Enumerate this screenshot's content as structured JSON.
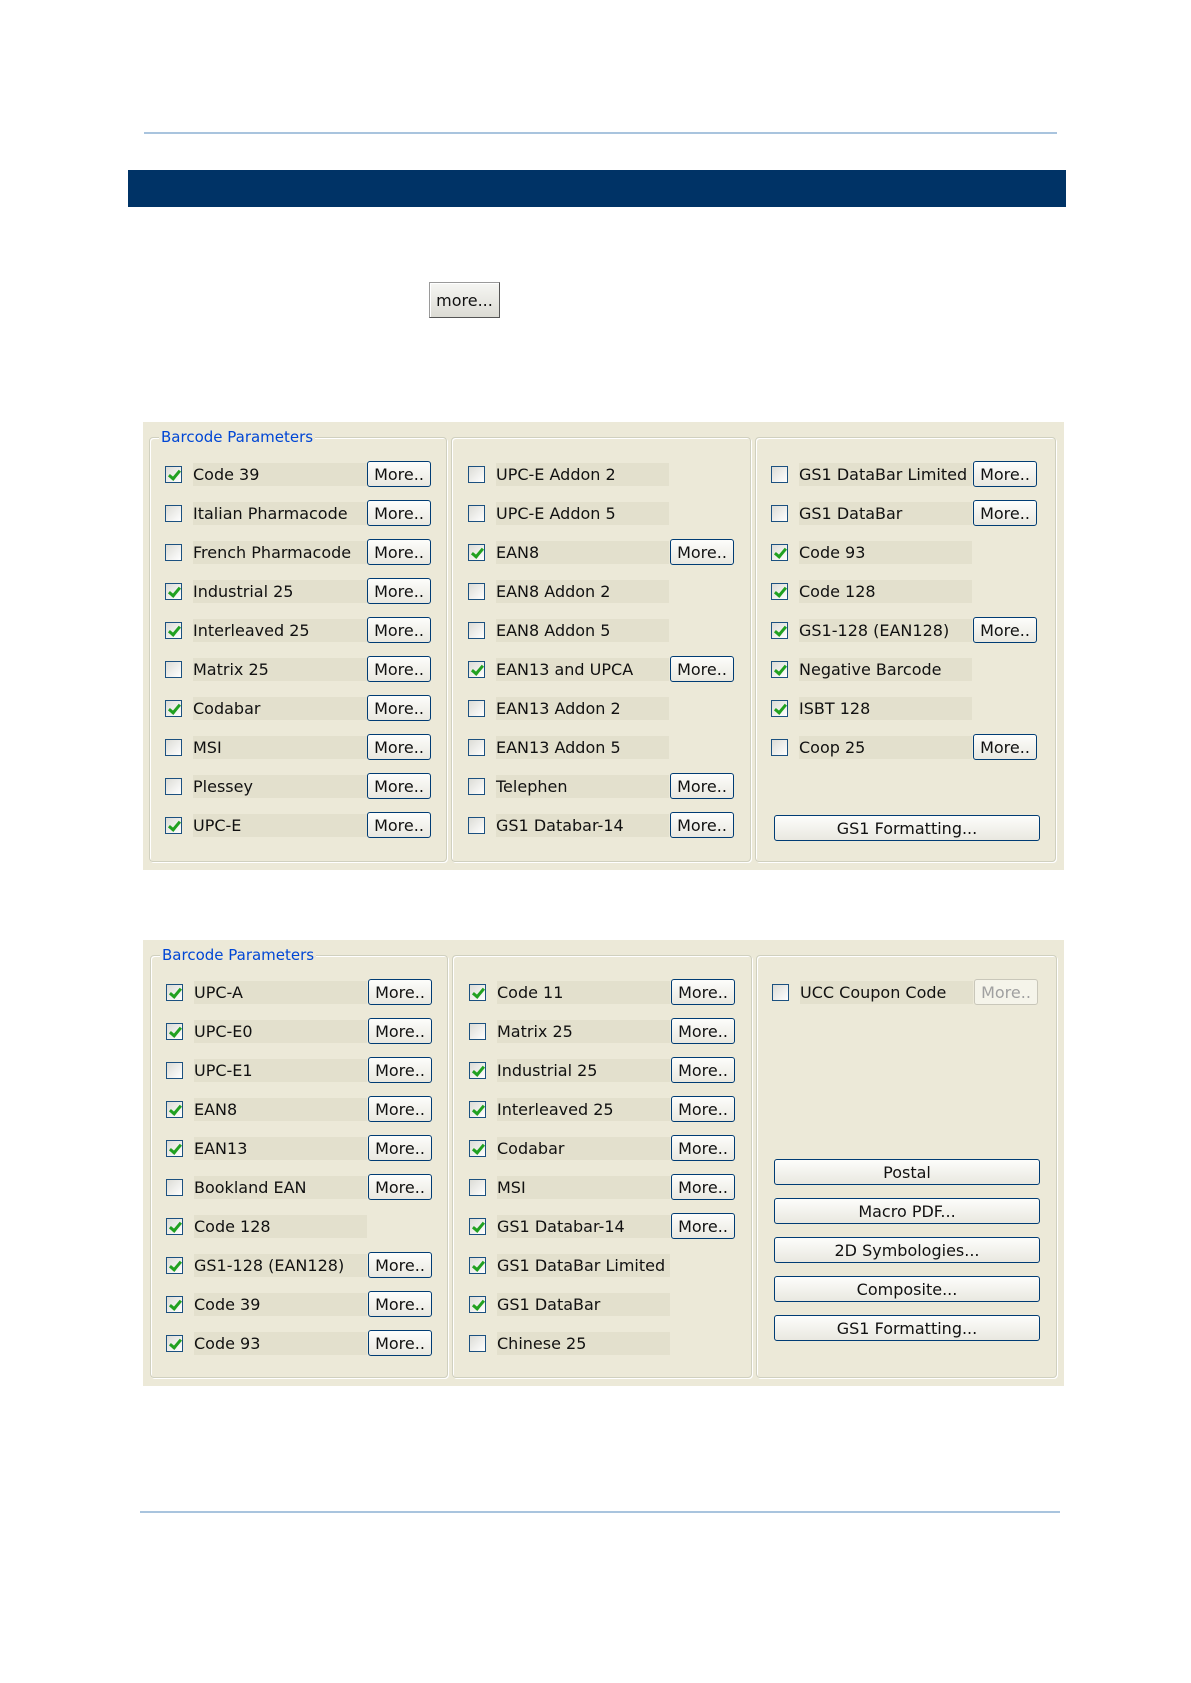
{
  "doc": {
    "more_button_label": "more..."
  },
  "dialog1": {
    "legend": "Barcode Parameters",
    "col1": [
      {
        "label": "Code 39",
        "checked": true,
        "more": "More.."
      },
      {
        "label": "Italian Pharmacode",
        "checked": false,
        "more": "More.."
      },
      {
        "label": "French Pharmacode",
        "checked": false,
        "more": "More.."
      },
      {
        "label": "Industrial 25",
        "checked": true,
        "more": "More.."
      },
      {
        "label": "Interleaved 25",
        "checked": true,
        "more": "More.."
      },
      {
        "label": "Matrix 25",
        "checked": false,
        "more": "More.."
      },
      {
        "label": "Codabar",
        "checked": true,
        "more": "More.."
      },
      {
        "label": "MSI",
        "checked": false,
        "more": "More.."
      },
      {
        "label": "Plessey",
        "checked": false,
        "more": "More.."
      },
      {
        "label": "UPC-E",
        "checked": true,
        "more": "More.."
      }
    ],
    "col2": [
      {
        "label": "UPC-E Addon 2",
        "checked": false,
        "more": ""
      },
      {
        "label": "UPC-E Addon 5",
        "checked": false,
        "more": ""
      },
      {
        "label": "EAN8",
        "checked": true,
        "more": "More.."
      },
      {
        "label": "EAN8 Addon 2",
        "checked": false,
        "more": ""
      },
      {
        "label": "EAN8 Addon 5",
        "checked": false,
        "more": ""
      },
      {
        "label": "EAN13 and UPCA",
        "checked": true,
        "more": "More.."
      },
      {
        "label": "EAN13 Addon 2",
        "checked": false,
        "more": ""
      },
      {
        "label": "EAN13 Addon 5",
        "checked": false,
        "more": ""
      },
      {
        "label": "Telephen",
        "checked": false,
        "more": "More.."
      },
      {
        "label": "GS1 Databar-14",
        "checked": false,
        "more": "More.."
      }
    ],
    "col3": [
      {
        "label": "GS1 DataBar Limited",
        "checked": false,
        "more": "More.."
      },
      {
        "label": "GS1 DataBar",
        "checked": false,
        "more": "More.."
      },
      {
        "label": "Code 93",
        "checked": true,
        "more": ""
      },
      {
        "label": "Code 128",
        "checked": true,
        "more": ""
      },
      {
        "label": "GS1-128 (EAN128)",
        "checked": true,
        "more": "More.."
      },
      {
        "label": "Negative Barcode",
        "checked": true,
        "more": ""
      },
      {
        "label": "ISBT 128",
        "checked": true,
        "more": ""
      },
      {
        "label": "Coop 25",
        "checked": false,
        "more": "More.."
      }
    ],
    "gs1_formatting_label": "GS1 Formatting..."
  },
  "dialog2": {
    "legend": "Barcode Parameters",
    "col1": [
      {
        "label": "UPC-A",
        "checked": true,
        "more": "More.."
      },
      {
        "label": "UPC-E0",
        "checked": true,
        "more": "More.."
      },
      {
        "label": "UPC-E1",
        "checked": false,
        "more": "More.."
      },
      {
        "label": "EAN8",
        "checked": true,
        "more": "More.."
      },
      {
        "label": "EAN13",
        "checked": true,
        "more": "More.."
      },
      {
        "label": "Bookland EAN",
        "checked": false,
        "more": "More.."
      },
      {
        "label": "Code 128",
        "checked": true,
        "more": ""
      },
      {
        "label": "GS1-128 (EAN128)",
        "checked": true,
        "more": "More.."
      },
      {
        "label": "Code 39",
        "checked": true,
        "more": "More.."
      },
      {
        "label": "Code 93",
        "checked": true,
        "more": "More.."
      }
    ],
    "col2": [
      {
        "label": "Code 11",
        "checked": true,
        "more": "More.."
      },
      {
        "label": "Matrix 25",
        "checked": false,
        "more": "More.."
      },
      {
        "label": "Industrial 25",
        "checked": true,
        "more": "More.."
      },
      {
        "label": "Interleaved 25",
        "checked": true,
        "more": "More.."
      },
      {
        "label": "Codabar",
        "checked": true,
        "more": "More.."
      },
      {
        "label": "MSI",
        "checked": false,
        "more": "More.."
      },
      {
        "label": "GS1 Databar-14",
        "checked": true,
        "more": "More.."
      },
      {
        "label": "GS1 DataBar Limited",
        "checked": true,
        "more": ""
      },
      {
        "label": "GS1 DataBar",
        "checked": true,
        "more": ""
      },
      {
        "label": "Chinese 25",
        "checked": false,
        "more": ""
      }
    ],
    "col3_checkbox": {
      "label": "UCC Coupon Code",
      "checked": false,
      "more": "More.."
    },
    "col3_buttons": [
      "Postal",
      "Macro PDF...",
      "2D Symbologies...",
      "Composite...",
      "GS1 Formatting..."
    ]
  }
}
